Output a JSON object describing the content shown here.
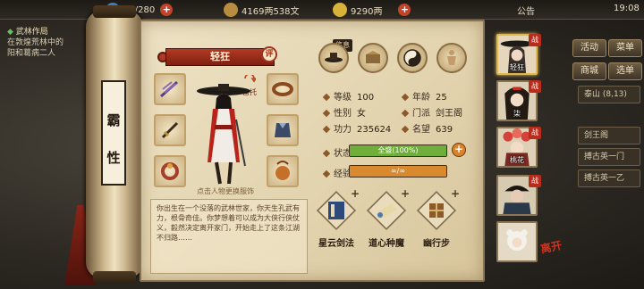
{
  "topbar": {
    "stamina": "28/280",
    "copper": "4169两538文",
    "gold": "9290两",
    "notice": "公告",
    "time": "19:08"
  },
  "quest": {
    "title": "武林作局",
    "line1": "在敦煌荒林中的",
    "line2": "阳和葛病二人"
  },
  "side_buttons": [
    "活动",
    "菜单",
    "商城",
    "选单"
  ],
  "side_info": "泰山 (8,13)",
  "side_list": [
    "剑王阁",
    "搏古英一门",
    "搏古英一乙"
  ],
  "scroll_title": [
    "霸",
    "性"
  ],
  "character": {
    "name": "轻狂",
    "comment_badge": "评",
    "swap_hint": "备托",
    "caption": "点击人物更换服饰",
    "description": "你出生在一个没落的武林世家，你天生孔武有力，根骨奇佳。你梦想着可以成为大侠行侠仗义，毅然决定离开家门，开始走上了这条江湖不归路……"
  },
  "top_icons": [
    "hat-icon",
    "box-icon",
    "yinyang-icon",
    "body-icon"
  ],
  "selected_tag": "信息",
  "stats": {
    "level_label": "等级",
    "level": "100",
    "age_label": "年龄",
    "age": "25",
    "gender_label": "性别",
    "gender": "女",
    "sect_label": "门派",
    "sect": "剑王阁",
    "power_label": "功力",
    "power": "235624",
    "fame_label": "名望",
    "fame": "639",
    "state_label": "状态",
    "state_text": "全盛(100%)",
    "state_fraction": 1.0,
    "exp_label": "经验",
    "exp_text": "∞/∞",
    "exp_fraction": 1.0
  },
  "skills": [
    {
      "name": "星云剑法",
      "icon": "book-icon"
    },
    {
      "name": "道心种魔",
      "icon": "scroll-icon"
    },
    {
      "name": "幽行步",
      "icon": "bundle-icon"
    }
  ],
  "portraits": [
    {
      "name": "轻狂",
      "tag": "战"
    },
    {
      "name": "柒",
      "tag": "战"
    },
    {
      "name": "桃花",
      "tag": "战"
    },
    {
      "name": "",
      "tag": "战"
    },
    {
      "name": "",
      "tag": ""
    }
  ],
  "leave_label": "离开",
  "colors": {
    "banner": "#b23a24",
    "state_bar": "#6fae3a",
    "exp_bar": "#d98a2e",
    "panel": "#e8dcbc"
  }
}
